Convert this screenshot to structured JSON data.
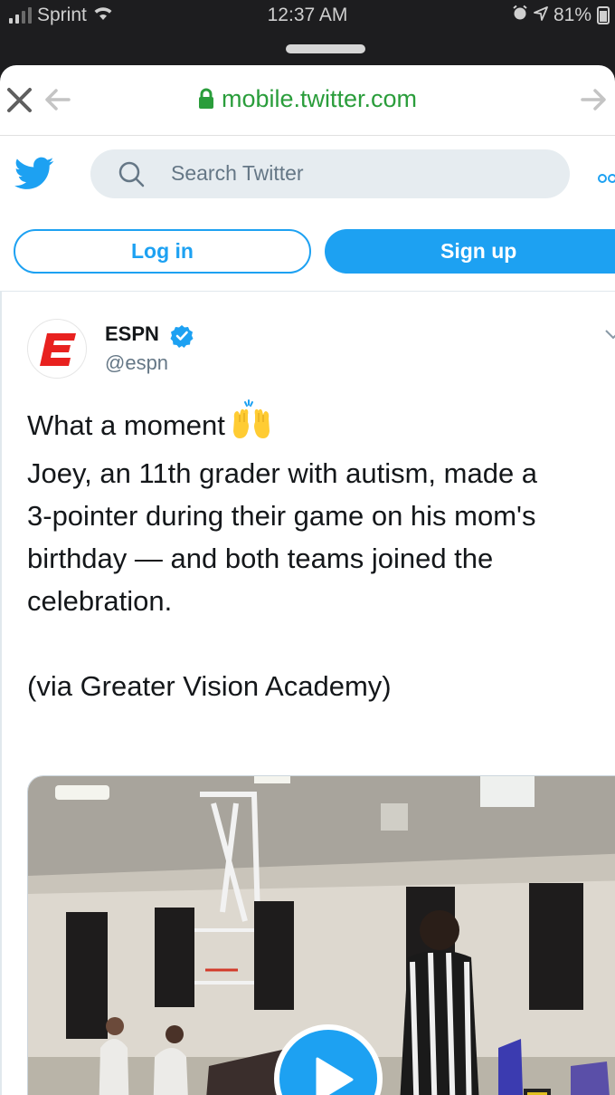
{
  "status_bar": {
    "carrier": "Sprint",
    "time": "12:37 AM",
    "battery": "81%"
  },
  "browser": {
    "url": "mobile.twitter.com"
  },
  "twitter_header": {
    "search_placeholder": "Search Twitter"
  },
  "auth": {
    "login_label": "Log in",
    "signup_label": "Sign up"
  },
  "tweet": {
    "author_name": "ESPN",
    "handle": "@espn",
    "lines": [
      "What a moment",
      "",
      "Joey, an 11th grader with autism, made a",
      "3-pointer during their game on his mom's",
      "birthday — and both teams joined the",
      "celebration.",
      "",
      "(via Greater Vision Academy)"
    ]
  },
  "colors": {
    "twitter_blue": "#1da1f2",
    "url_green": "#2a9d3b",
    "espn_red": "#e8211f"
  },
  "icons": [
    "signal-icon",
    "wifi-icon",
    "alarm-icon",
    "location-icon",
    "battery-icon",
    "close-icon",
    "back-arrow-icon",
    "forward-arrow-icon",
    "lock-icon",
    "twitter-bird-icon",
    "search-icon",
    "more-icon",
    "verified-badge-icon",
    "chevron-down-icon",
    "raised-hands-emoji",
    "play-icon"
  ]
}
